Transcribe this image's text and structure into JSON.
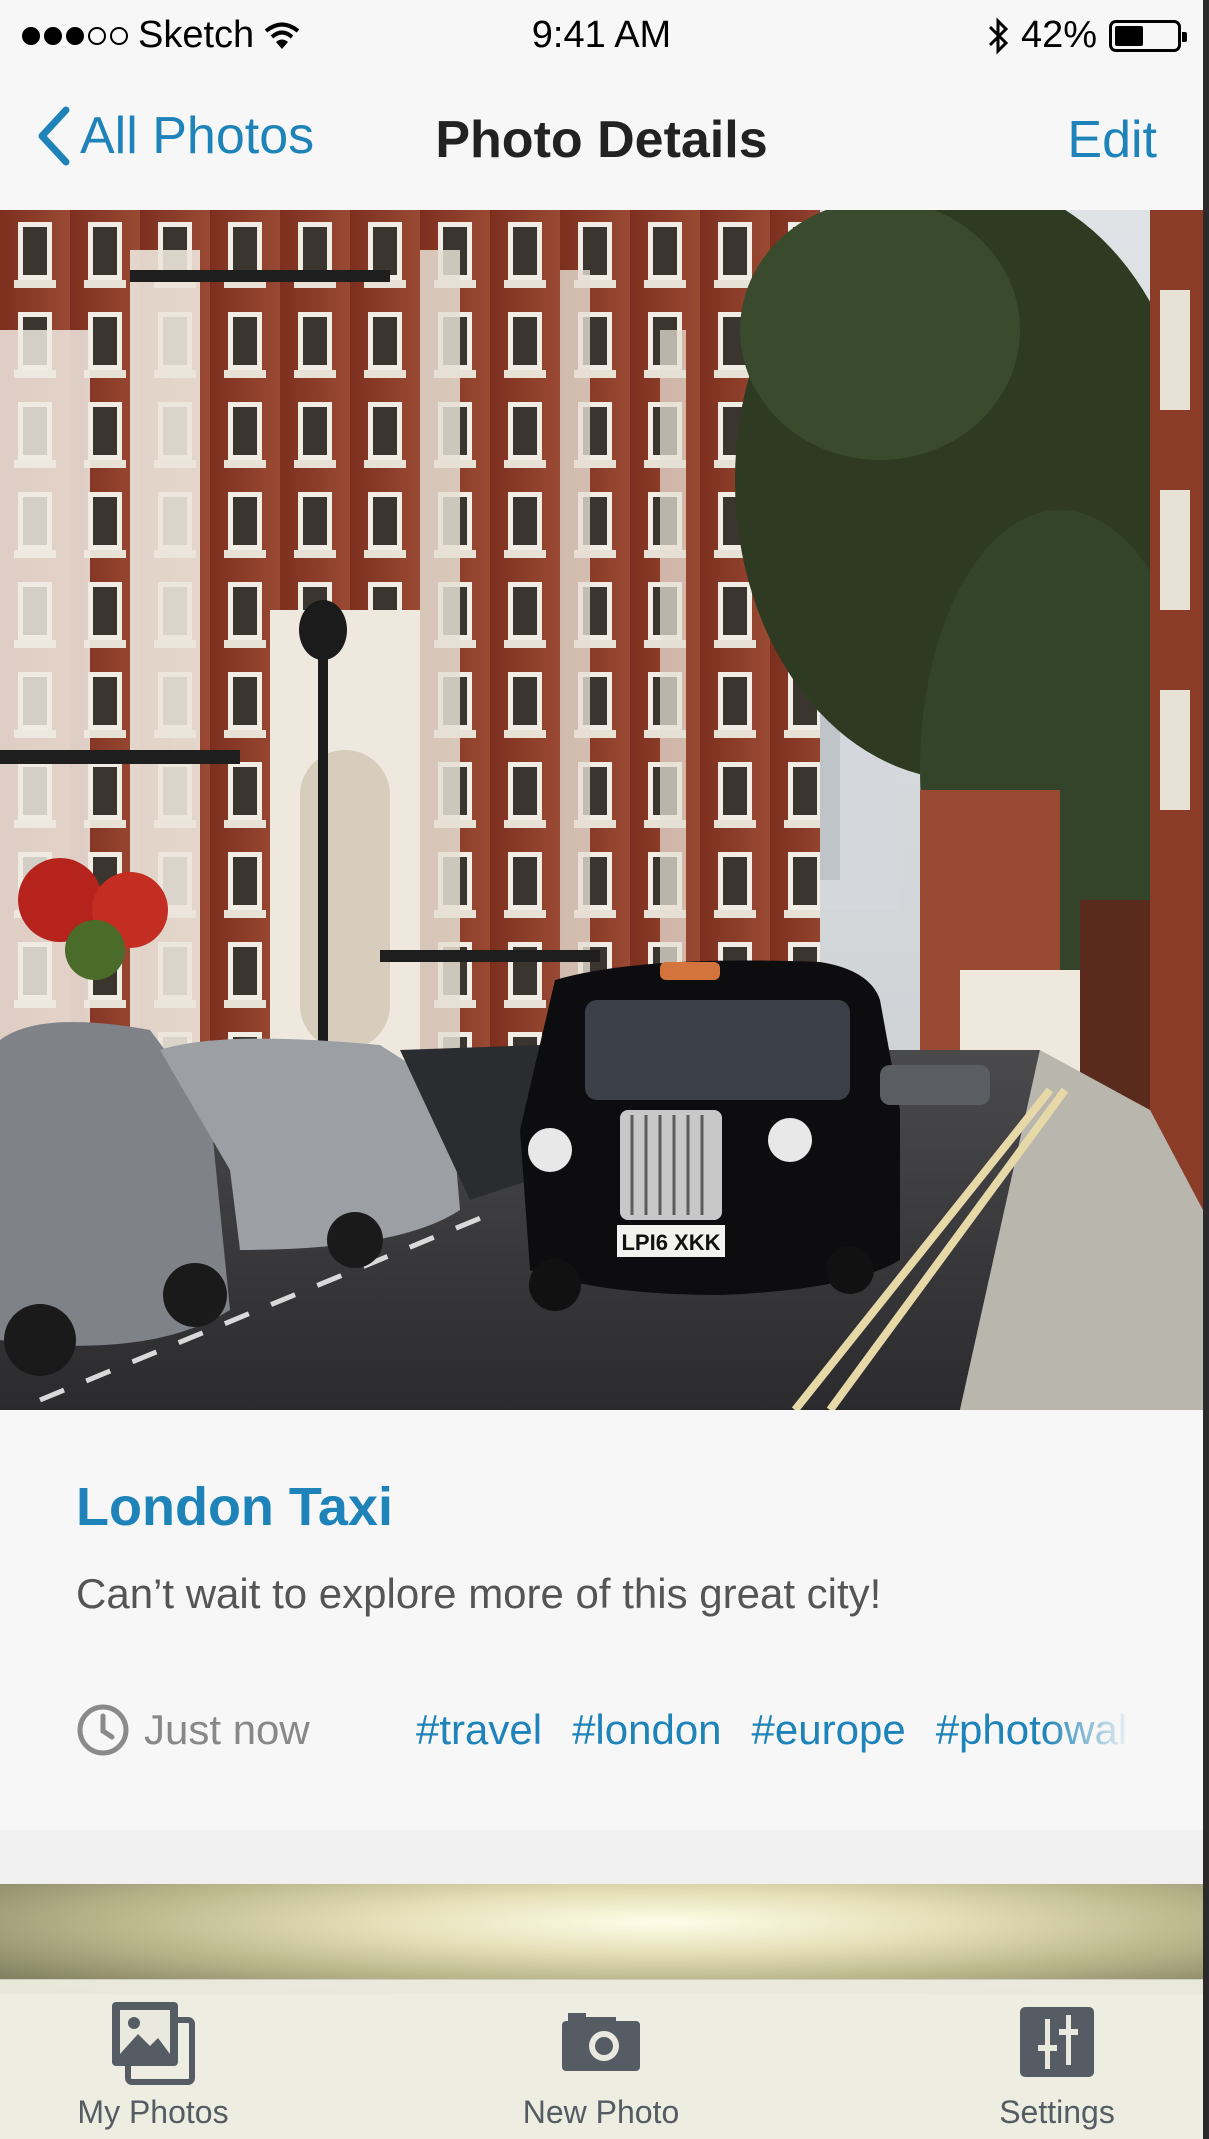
{
  "status_bar": {
    "carrier": "Sketch",
    "time": "9:41 AM",
    "battery": "42%",
    "battery_level": 0.42
  },
  "nav": {
    "back_label": "All Photos",
    "title": "Photo Details",
    "edit_label": "Edit"
  },
  "photo": {
    "plate": "LPI6 XKK"
  },
  "details": {
    "title": "London Taxi",
    "caption": "Can’t wait to explore more of this great city!",
    "timestamp": "Just now",
    "tags": [
      "#travel",
      "#london",
      "#europe",
      "#photowal"
    ]
  },
  "tabs": [
    {
      "label": "My Photos",
      "icon": "photos-icon"
    },
    {
      "label": "New Photo",
      "icon": "camera-icon"
    },
    {
      "label": "Settings",
      "icon": "settings-icon"
    }
  ],
  "colors": {
    "accent": "#1d83b8",
    "tab_icon": "#555c63",
    "brick": "#8e3b26"
  }
}
